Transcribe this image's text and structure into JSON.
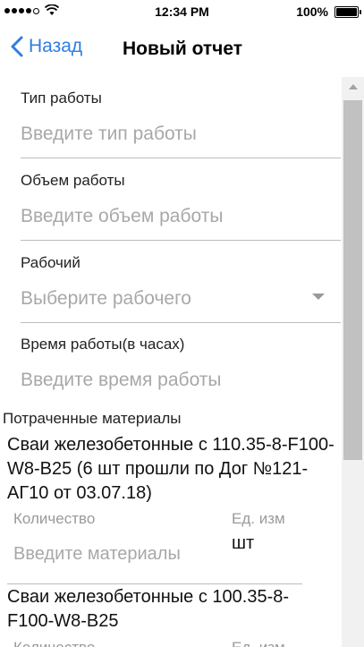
{
  "status_bar": {
    "time": "12:34 PM",
    "battery_percent": "100%",
    "signal_strength": 4,
    "battery_level": 1.0
  },
  "nav": {
    "back_label": "Назад",
    "title": "Новый отчет"
  },
  "form": {
    "work_type": {
      "label": "Тип работы",
      "placeholder": "Введите тип работы"
    },
    "work_volume": {
      "label": "Объем работы",
      "placeholder": "Введите объем работы"
    },
    "worker": {
      "label": "Рабочий",
      "placeholder": "Выберите рабочего"
    },
    "work_time": {
      "label": "Время работы(в часах)",
      "placeholder": "Введите время работы"
    }
  },
  "materials": {
    "section_title": "Потраченные материалы",
    "items": [
      {
        "name": "Сваи железобетонные с 110.35-8-F100-W8-B25 (6 шт прошли по Дог №121-АГ10 от 03.07.18)",
        "qty_label": "Количество",
        "unit_label": "Ед. изм",
        "qty_placeholder": "Введите материалы",
        "unit": "шт"
      },
      {
        "name": "Сваи железобетонные с 100.35-8-F100-W8-B25",
        "qty_label": "Количество",
        "unit_label": "Ед. изм"
      }
    ]
  },
  "colors": {
    "accent": "#2f7de1",
    "placeholder": "#a8a8a8",
    "divider": "#bdbdbd"
  }
}
